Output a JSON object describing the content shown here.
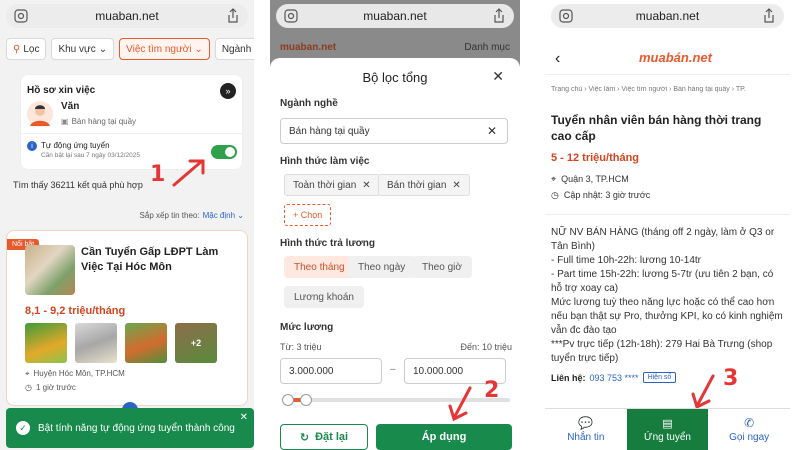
{
  "site_domain": "muaban.net",
  "screen1": {
    "filters": [
      "Lọc",
      "Khu vực",
      "Việc tìm người",
      "Ngành n"
    ],
    "profile_title": "Hồ sơ xin việc",
    "user_name": "Văn",
    "user_job": "Bán hàng tại quầy",
    "auto_apply_label": "Tự động ứng tuyển",
    "auto_apply_note": "Cần bật lại sau 7 ngày 03/12/2025",
    "result_count_text": "Tìm thấy 36211 kết quả phù hợp",
    "sort_label": "Sắp xếp tin theo:",
    "sort_value": "Mặc định",
    "badge": "Nổi bật",
    "listing_title": "Cần Tuyển Gấp LĐPT Làm Việc Tại Hóc Môn",
    "salary": "8,1 - 9,2 triệu/tháng",
    "more_photos": "+2",
    "location": "Huyện Hóc Môn, TP.HCM",
    "time_ago": "1 giờ trước",
    "toast": "Bật tính năng tự động ứng tuyển thành công",
    "step_label": "1"
  },
  "screen2": {
    "top_banner_left": "muaban.net",
    "top_banner_right": "Danh mục",
    "title": "Bộ lọc tổng",
    "industry_label": "Ngành nghề",
    "industry_value": "Bán hàng tại quầy",
    "worktype_label": "Hình thức làm việc",
    "worktypes": [
      "Toàn thời gian",
      "Bán thời gian"
    ],
    "choose_label": "+ Chọn",
    "paytype_label": "Hình thức trả lương",
    "paytypes": [
      "Theo tháng",
      "Theo ngày",
      "Theo giờ",
      "Lương khoán"
    ],
    "salary_label": "Mức lương",
    "from_label": "Từ: 3 triệu",
    "to_label": "Đến: 10 triệu",
    "from_value": "3.000.000",
    "to_value": "10.000.000",
    "dash": "–",
    "reset_label": "Đặt lại",
    "apply_label": "Áp dụng",
    "step_label": "2"
  },
  "screen3": {
    "logo": "muabán.net",
    "breadcrumb": "Trang chủ  ›  Việc làm  ›  Việc tìm người  ›  Bán hàng tại quầy  ›  TP.",
    "job_title": "Tuyển nhân viên bán hàng thời trang cao cấp",
    "salary": "5 - 12 triệu/tháng",
    "location": "Quận 3, TP.HCM",
    "updated": "Cập nhật: 3 giờ trước",
    "desc": [
      "NỮ NV BÁN HÀNG (tháng off 2 ngày, làm ở Q3 or Tân Bình)",
      "- Full time 10h-22h: lương 10-14tr",
      "- Part time 15h-22h: lương 5-7tr (ưu tiên 2 bạn, có hỗ trợ xoay ca)",
      "Mức lương tuỳ theo năng lực hoặc có thể cao hơn nếu bạn thật sự Pro, thưởng KPI, ko có kinh nghiệm vẫn đc đào tạo",
      "***Pv trực tiếp (12h-18h): 279 Hai Bà Trưng (shop tuyển trực tiếp)"
    ],
    "contact_label": "Liên hệ:",
    "phone": "093 753 ****",
    "show_number": "Hiện số",
    "nav": [
      "Nhắn tin",
      "Ứng tuyển",
      "Gọi ngay"
    ],
    "step_label": "3"
  },
  "colors": {
    "brand_orange": "#e8592b",
    "green": "#178a4c",
    "link_blue": "#2b64c9"
  }
}
